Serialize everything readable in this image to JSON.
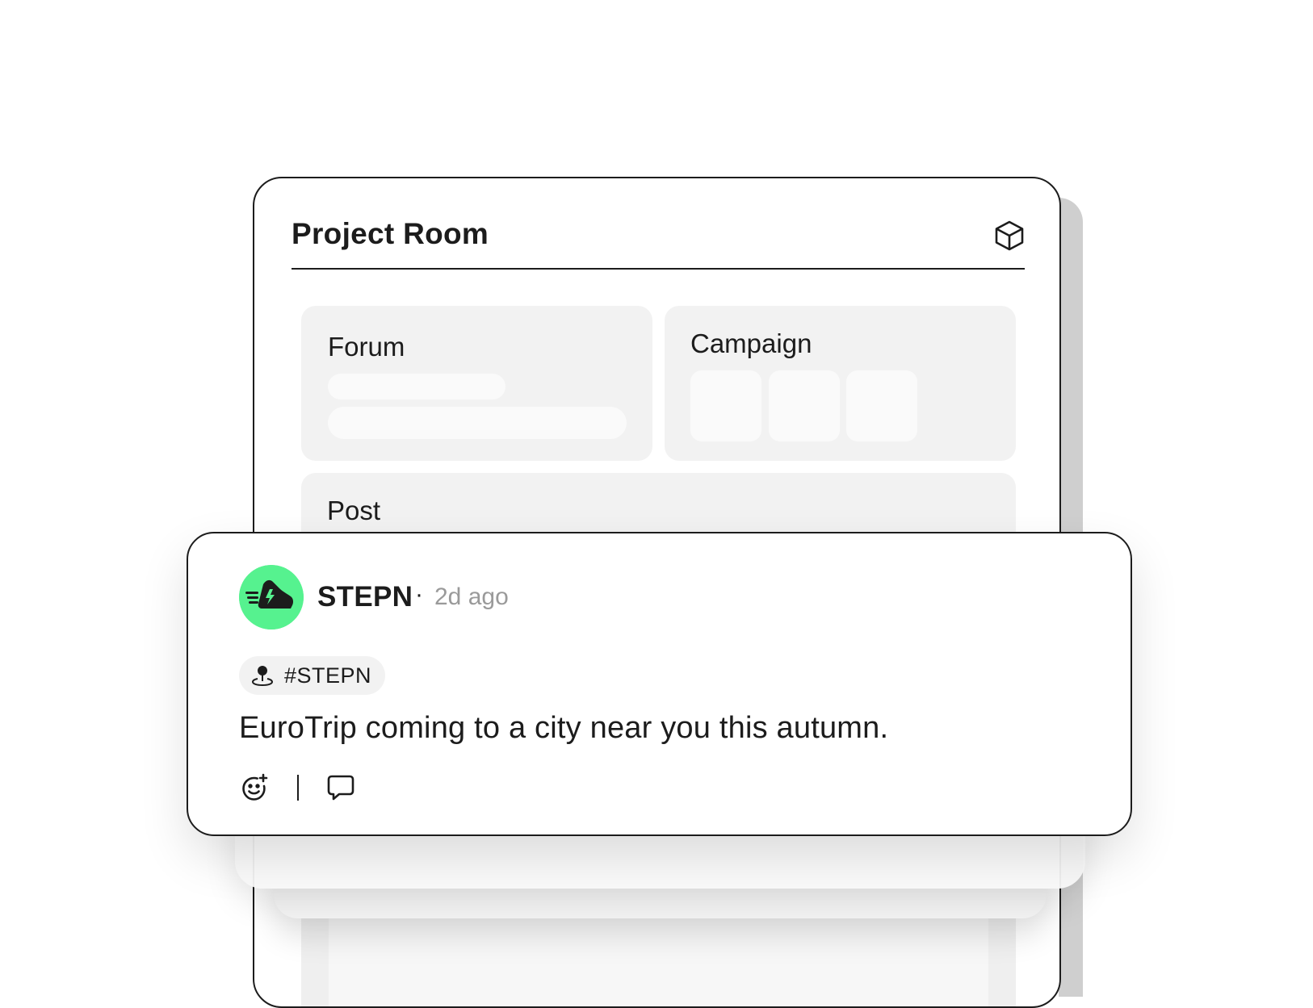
{
  "project_room": {
    "title": "Project Room",
    "header_icon": "cube-icon",
    "panels": {
      "forum": {
        "label": "Forum"
      },
      "campaign": {
        "label": "Campaign"
      },
      "post": {
        "label": "Post"
      }
    }
  },
  "post_card": {
    "author": "STEPN",
    "separator": "·",
    "time_ago": "2d ago",
    "avatar_icon": "sneaker-logo-icon",
    "tag": {
      "icon": "location-pin-icon",
      "label": "#STEPN"
    },
    "body": "EuroTrip coming to a city near you this autumn.",
    "actions": [
      {
        "icon": "add-reaction-icon"
      },
      {
        "icon": "comment-icon"
      }
    ]
  },
  "colors": {
    "accent": "#56F28F",
    "text": "#1C1C1C",
    "muted": "#9A9A9A",
    "panel": "#F2F2F2"
  }
}
